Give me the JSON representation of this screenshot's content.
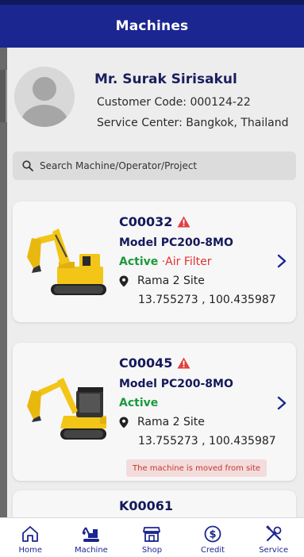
{
  "header": {
    "title": "Machines"
  },
  "profile": {
    "name": "Mr. Surak Sirisakul",
    "customer_code": "Customer Code: 000124-22",
    "service_center": "Service Center: Bangkok, Thailand"
  },
  "search": {
    "placeholder": "Search Machine/Operator/Project"
  },
  "machines": [
    {
      "code": "C00032",
      "model": "Model PC200-8MO",
      "status": "Active",
      "separator": " ·",
      "alert": "Air Filter",
      "site": "Rama 2 Site",
      "coords": "13.755273 , 100.435987",
      "warning": true
    },
    {
      "code": "C00045",
      "model": "Model PC200-8MO",
      "status": "Active",
      "site": "Rama 2 Site",
      "coords": "13.755273 , 100.435987",
      "note": "The machine is moved from site",
      "warning": true
    },
    {
      "code": "K00061"
    }
  ],
  "nav": [
    {
      "label": "Home",
      "icon": "home-icon"
    },
    {
      "label": "Machine",
      "icon": "excavator-icon"
    },
    {
      "label": "Shop",
      "icon": "shop-icon"
    },
    {
      "label": "Credit",
      "icon": "credit-icon"
    },
    {
      "label": "Service",
      "icon": "service-tools-icon"
    }
  ],
  "colors": {
    "header_bg": "#1b2690",
    "active": "#1a9a3c",
    "alert": "#e03030",
    "machine_yellow": "#f2c516",
    "warning_red": "#e04040",
    "nav_blue": "#1b2690"
  }
}
